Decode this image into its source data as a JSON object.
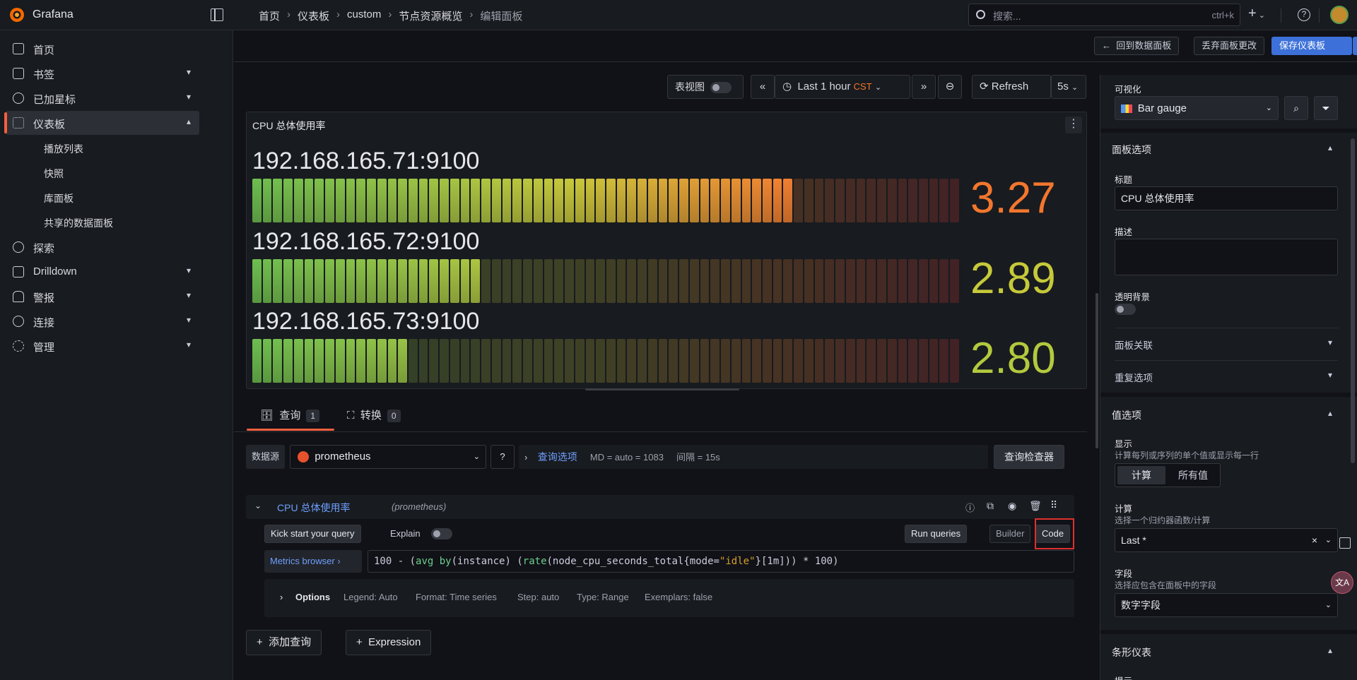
{
  "app": {
    "brand": "Grafana"
  },
  "breadcrumb": [
    {
      "label": "首页"
    },
    {
      "label": "仪表板"
    },
    {
      "label": "custom"
    },
    {
      "label": "节点资源概览"
    },
    {
      "label": "编辑面板"
    }
  ],
  "search": {
    "placeholder": "搜索...",
    "shortcut": "ctrl+k"
  },
  "sidebar": {
    "items": [
      {
        "label": "首页",
        "icon": "home-icon"
      },
      {
        "label": "书签",
        "icon": "bookmark-icon"
      },
      {
        "label": "已加星标",
        "icon": "star-icon"
      },
      {
        "label": "仪表板",
        "icon": "dashboards-icon"
      },
      {
        "label": "探索",
        "icon": "compass-icon"
      },
      {
        "label": "Drilldown",
        "icon": "drilldown-icon"
      },
      {
        "label": "警报",
        "icon": "bell-icon"
      },
      {
        "label": "连接",
        "icon": "connections-icon"
      },
      {
        "label": "管理",
        "icon": "gear-icon"
      }
    ],
    "sub_items": [
      {
        "label": "播放列表"
      },
      {
        "label": "快照"
      },
      {
        "label": "库面板"
      },
      {
        "label": "共享的数据面板"
      }
    ]
  },
  "savebar": {
    "back": "回到数据面板",
    "discard": "丢弃面板更改",
    "save": "保存仪表板"
  },
  "toolbar": {
    "table_view": "表视图",
    "time_range": "Last 1 hour",
    "timezone": "CST",
    "refresh": "Refresh",
    "refresh_interval": "5s"
  },
  "panel": {
    "title": "CPU 总体使用率",
    "gauges": [
      {
        "name": "192.168.165.71:9100",
        "value": "3.27",
        "color": "#f2762e",
        "fill_fraction": 0.76
      },
      {
        "name": "192.168.165.72:9100",
        "value": "2.89",
        "color": "#c6c93a",
        "fill_fraction": 0.33
      },
      {
        "name": "192.168.165.73:9100",
        "value": "2.80",
        "color": "#b3c93e",
        "fill_fraction": 0.22
      }
    ]
  },
  "query_tabs": [
    {
      "label": "查询",
      "count": "1"
    },
    {
      "label": "转换",
      "count": "0"
    }
  ],
  "query": {
    "datasource_label": "数据源",
    "datasource": "prometheus",
    "options_label": "查询选项",
    "md": "MD = auto = 1083",
    "interval": "间隔 = 15s",
    "inspector": "查询检查器",
    "name": "CPU 总体使用率",
    "source": "(prometheus)",
    "kick_start": "Kick start your query",
    "explain": "Explain",
    "run": "Run queries",
    "builder": "Builder",
    "code": "Code",
    "metrics_browser": "Metrics browser",
    "expr_parts": {
      "p1": "100 - (",
      "fn1": "avg",
      "p2": " ",
      "kw": "by",
      "p3": "(",
      "lab": "instance",
      "p4": ") (",
      "fn2": "rate",
      "p5": "(node_cpu_seconds_total{",
      "lab2": "mode",
      "p6": "=",
      "str": "\"idle\"",
      "p7": "}[",
      "num": "1m",
      "p8": "])) * 100)"
    },
    "options": {
      "title": "Options",
      "legend": "Legend: Auto",
      "format": "Format: Time series",
      "step": "Step: auto",
      "type": "Type: Range",
      "exemplars": "Exemplars: false"
    },
    "add_query": "添加查询",
    "add_expression": "Expression"
  },
  "options_pane": {
    "viz_label": "可视化",
    "viz": "Bar gauge",
    "panel_options": "面板选项",
    "title_label": "标题",
    "title_value": "CPU 总体使用率",
    "desc_label": "描述",
    "transparent_label": "透明背景",
    "links": "面板关联",
    "repeat": "重复选项",
    "value_options": "值选项",
    "show_label": "显示",
    "show_desc": "计算每列或序列的单个值或显示每一行",
    "show_calc": "计算",
    "show_all": "所有值",
    "calc_label": "计算",
    "calc_desc": "选择一个归约器函数/计算",
    "calc_value": "Last *",
    "field_label": "字段",
    "field_desc": "选择应包含在面板中的字段",
    "field_value": "数字字段",
    "bar_gauge": "条形仪表",
    "cut_label": "提示"
  }
}
